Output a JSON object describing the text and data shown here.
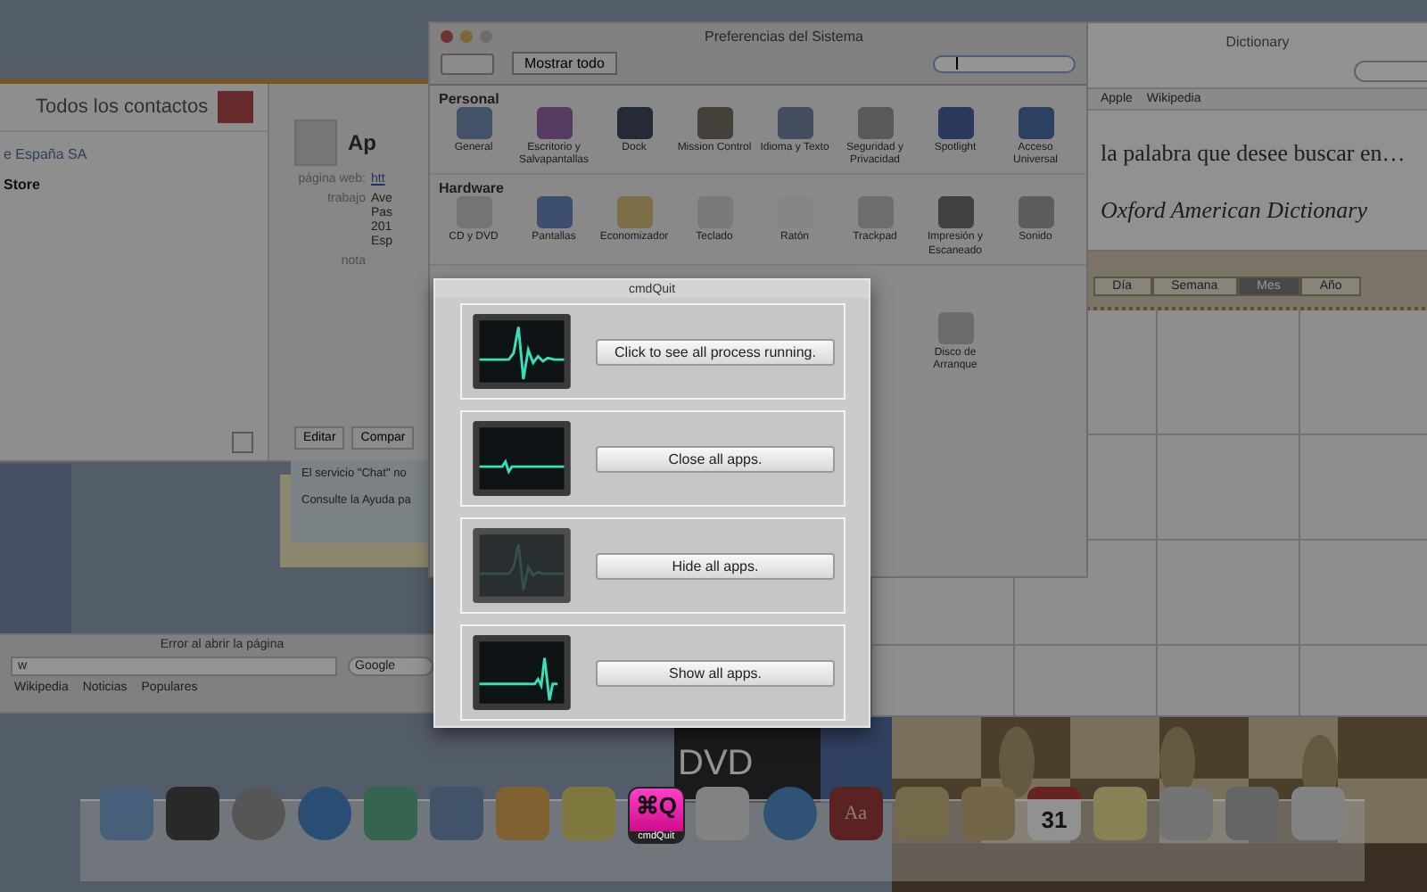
{
  "contacts_window": {
    "search_placeholder": "Todos los contactos",
    "groups": [
      "e España SA",
      "Store"
    ],
    "card_name": "Ap",
    "field_label": "página web:",
    "field_value": "htt",
    "address_label": "trabajo",
    "address_lines": [
      "Ave",
      "Pas",
      "201",
      "Esp"
    ],
    "note_label": "nota",
    "buttons": [
      "Editar",
      "Compar"
    ]
  },
  "sticky_note": {
    "lines": [
      "El servicio \"Chat\" no",
      "Consulte la Ayuda pa"
    ]
  },
  "browser_window": {
    "status": "Error al abrir la página",
    "address": "w",
    "search": "Google",
    "bookmarks": [
      "Wikipedia",
      "Noticias",
      "Populares"
    ]
  },
  "dvd_window": {
    "title": "DVD"
  },
  "system_preferences": {
    "title": "Preferencias del Sistema",
    "show_all": "Mostrar todo",
    "sections": [
      {
        "title": "Personal",
        "items": [
          {
            "label": "General",
            "kind": "general"
          },
          {
            "label": "Escritorio y Salvapantallas",
            "kind": "desktop"
          },
          {
            "label": "Dock",
            "kind": "dock"
          },
          {
            "label": "Mission Control",
            "kind": "mission"
          },
          {
            "label": "Idioma y Texto",
            "kind": "language"
          },
          {
            "label": "Seguridad y Privacidad",
            "kind": "security"
          },
          {
            "label": "Spotlight",
            "kind": "spotlight"
          },
          {
            "label": "Acceso Universal",
            "kind": "access"
          }
        ]
      },
      {
        "title": "Hardware",
        "items": [
          {
            "label": "CD y DVD",
            "kind": "cd"
          },
          {
            "label": "Pantallas",
            "kind": "display"
          },
          {
            "label": "Economizador",
            "kind": "bulb"
          },
          {
            "label": "Teclado",
            "kind": "keyboard"
          },
          {
            "label": "Ratón",
            "kind": "mouse"
          },
          {
            "label": "Trackpad",
            "kind": "trackpad"
          },
          {
            "label": "Impresión y Escaneado",
            "kind": "printer"
          },
          {
            "label": "Sonido",
            "kind": "speaker"
          }
        ]
      }
    ],
    "partial_row": [
      {
        "label": "Disco de Arranque",
        "kind": "disk"
      }
    ]
  },
  "dictionary_window": {
    "title": "Dictionary",
    "sources": [
      "Apple",
      "Wikipedia"
    ],
    "prompt": "la palabra que desee buscar en…",
    "source_line": "Oxford American Dictionary"
  },
  "calendar_window": {
    "views": [
      {
        "label": "Día",
        "selected": false
      },
      {
        "label": "Semana",
        "selected": false
      },
      {
        "label": "Mes",
        "selected": true
      },
      {
        "label": "Año",
        "selected": false
      }
    ]
  },
  "cmdquit_panel": {
    "title": "cmdQuit",
    "actions": [
      {
        "label": "Click to see all process running.",
        "monitor_dimmed": false
      },
      {
        "label": "Close all apps.",
        "monitor_dimmed": false
      },
      {
        "label": "Hide all apps.",
        "monitor_dimmed": true
      },
      {
        "label": "Show all apps.",
        "monitor_dimmed": false
      }
    ]
  },
  "dock": {
    "items": [
      {
        "kind": "finder"
      },
      {
        "kind": "dashboard"
      },
      {
        "kind": "launchpad"
      },
      {
        "kind": "appstore"
      },
      {
        "kind": "usb"
      },
      {
        "kind": "trash"
      },
      {
        "kind": "recycle"
      },
      {
        "kind": "wifi"
      },
      {
        "kind": "cmdquit",
        "glyph": "⌘Q",
        "label": "cmdQuit"
      },
      {
        "kind": "preview"
      },
      {
        "kind": "safari"
      },
      {
        "kind": "dictionary",
        "glyph": "Aa"
      },
      {
        "kind": "chess"
      },
      {
        "kind": "notebook"
      },
      {
        "kind": "calendar",
        "glyph": "31"
      },
      {
        "kind": "stickies"
      },
      {
        "kind": "badge"
      },
      {
        "kind": "settings"
      },
      {
        "kind": "glass"
      }
    ]
  }
}
